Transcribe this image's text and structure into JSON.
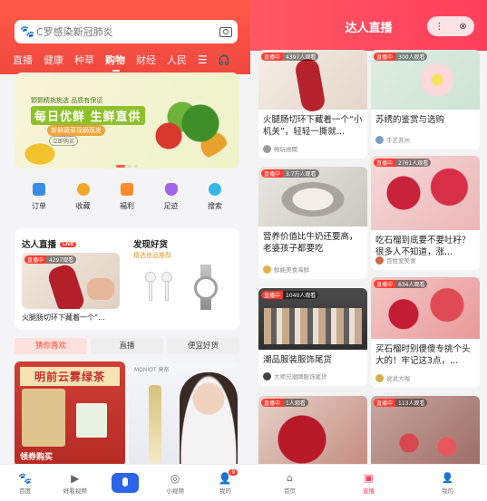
{
  "left": {
    "search": {
      "placeholder": "C罗感染新冠肺炎"
    },
    "tabs": [
      "直播",
      "健康",
      "种草",
      "购物",
      "财经",
      "人民"
    ],
    "active_tab": "购物",
    "banner": {
      "top": "颗颗精挑挑选 品质有保证",
      "big": "每日优鲜 生鲜直供",
      "sub": "新鲜蔬菜现摘现发",
      "pill": "立即购买"
    },
    "quick": [
      {
        "label": "订单",
        "color": "#3a8ce6"
      },
      {
        "label": "收藏",
        "color": "#f0a728"
      },
      {
        "label": "福利",
        "color": "#ff8a29"
      },
      {
        "label": "足迹",
        "color": "#a264e6"
      },
      {
        "label": "搜索",
        "color": "#33b8e6"
      }
    ],
    "live": {
      "title": "达人直播",
      "tag": "LIVE",
      "badge": "直播中",
      "viewers": "4297观看",
      "caption": "火腿肠切环下藏着一个“..."
    },
    "discover": {
      "title": "发现好货",
      "sub": "精选良品推荐"
    },
    "segments": [
      "猜你喜欢",
      "直播",
      "便宜好货"
    ],
    "products": {
      "tea": "明前云雾绿茶",
      "tea_tag": "领券购买",
      "wine_brand": "MONIOT 莫奈"
    },
    "tabbar": [
      "百度",
      "好看视频",
      "",
      "小视频",
      "我的"
    ],
    "badge_me": "9"
  },
  "right": {
    "title": "达人直播",
    "cards": [
      {
        "badge": "直播中",
        "viewers": "4397人观看",
        "title": "火腿肠切环下藏着一个“小机关”，轻轻一撕就...",
        "author": "畅玩視聞"
      },
      {
        "badge": "直播中",
        "viewers": "300人观看",
        "title": "苏绣的鉴赏与选购",
        "author": "手艺苏州"
      },
      {
        "badge": "直播中",
        "viewers": "3.7万人观看",
        "title": "营养价值比牛奶还要高，老婆孩子都要吃",
        "author": "鲜蚝美食海鲜"
      },
      {
        "badge": "直播中",
        "viewers": "2761人观看",
        "title": "吃石榴到底要不要吐籽？很多人不知道，涨...",
        "author": "百姓爱美食"
      },
      {
        "badge": "直播中",
        "viewers": "1040人观看",
        "title": "潮品服装服饰尾货",
        "author": "大师兄潮牌服饰尾货"
      },
      {
        "badge": "直播中",
        "viewers": "634人观看",
        "title": "买石榴时别傻傻专挑个头大的！牢记这3点，...",
        "author": "说说大咖"
      },
      {
        "badge": "直播中",
        "viewers": "1人观看",
        "title": "",
        "author": ""
      },
      {
        "badge": "直播中",
        "viewers": "113人观看",
        "title": "",
        "author": ""
      }
    ],
    "tabbar": [
      "首页",
      "直播",
      "我的"
    ]
  }
}
